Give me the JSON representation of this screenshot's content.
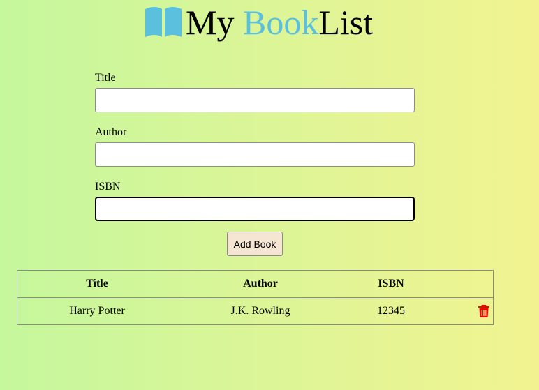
{
  "header": {
    "title_part1": "My ",
    "title_accent": "Book",
    "title_part2": "List",
    "logo_icon": "open-book-icon"
  },
  "form": {
    "title_label": "Title",
    "title_value": "",
    "author_label": "Author",
    "author_value": "",
    "isbn_label": "ISBN",
    "isbn_value": "",
    "submit_label": "Add Book"
  },
  "table": {
    "headers": [
      "Title",
      "Author",
      "ISBN"
    ],
    "rows": [
      {
        "title": "Harry Potter",
        "author": "J.K. Rowling",
        "isbn": "12345",
        "action_icon": "trash-icon"
      }
    ]
  },
  "colors": {
    "accent": "#5bc0de",
    "delete": "#ff0000",
    "button_bg": "#f5e6d3",
    "gradient_start": "#c5f79d",
    "gradient_end": "#f2f390"
  }
}
